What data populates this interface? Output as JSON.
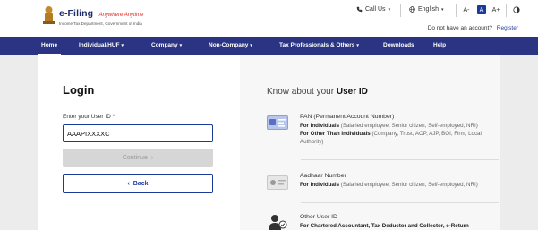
{
  "brand": {
    "name": "e-Filing",
    "tagline": "Anywhere Anytime",
    "subtitle": "Income Tax Department, Government of India"
  },
  "utility": {
    "call_us": "Call Us",
    "language": "English",
    "font_decrease": "A-",
    "font_normal": "A",
    "font_increase": "A+",
    "no_account_text": "Do not have an account?",
    "register_label": "Register"
  },
  "nav": {
    "items": [
      {
        "label": "Home",
        "has_caret": false
      },
      {
        "label": "Individual/HUF",
        "has_caret": true
      },
      {
        "label": "Company",
        "has_caret": true
      },
      {
        "label": "Non-Company",
        "has_caret": true
      },
      {
        "label": "Tax Professionals & Others",
        "has_caret": true
      },
      {
        "label": "Downloads",
        "has_caret": false
      },
      {
        "label": "Help",
        "has_caret": false
      }
    ],
    "caret_glyph": "▾"
  },
  "login": {
    "title": "Login",
    "user_id_label": "Enter your User ID",
    "required_mark": "*",
    "user_id_value": "AAAPIXXXXC",
    "continue_label": "Continue",
    "continue_glyph": "›",
    "back_label": "Back",
    "back_glyph": "‹"
  },
  "info": {
    "heading_prefix": "Know about your",
    "heading_bold": "User ID",
    "pan": {
      "title": "PAN (Permanent Account Number)",
      "for_individuals_label": "For Individuals",
      "for_individuals_detail": " (Salaried employee, Senior citizen, Self-employed, NRI)",
      "for_others_label": "For Other Than Individuals",
      "for_others_detail": " (Company, Trust, AOP, AJP, BOI, Firm, Local Authority)"
    },
    "aadhaar": {
      "title": "Aadhaar Number",
      "for_individuals_label": "For Individuals",
      "for_individuals_detail": " (Salaried employee, Senior citizen, Self-employed, NRI)"
    },
    "other": {
      "title": "Other User ID",
      "detail_bold": "For Chartered Accountant, Tax Deductor and Collector, e-Return"
    }
  },
  "colors": {
    "nav_bg": "#2a3483",
    "accent": "#1c3a9b",
    "brand_red": "#e2231a",
    "page_bg": "#ececec"
  }
}
